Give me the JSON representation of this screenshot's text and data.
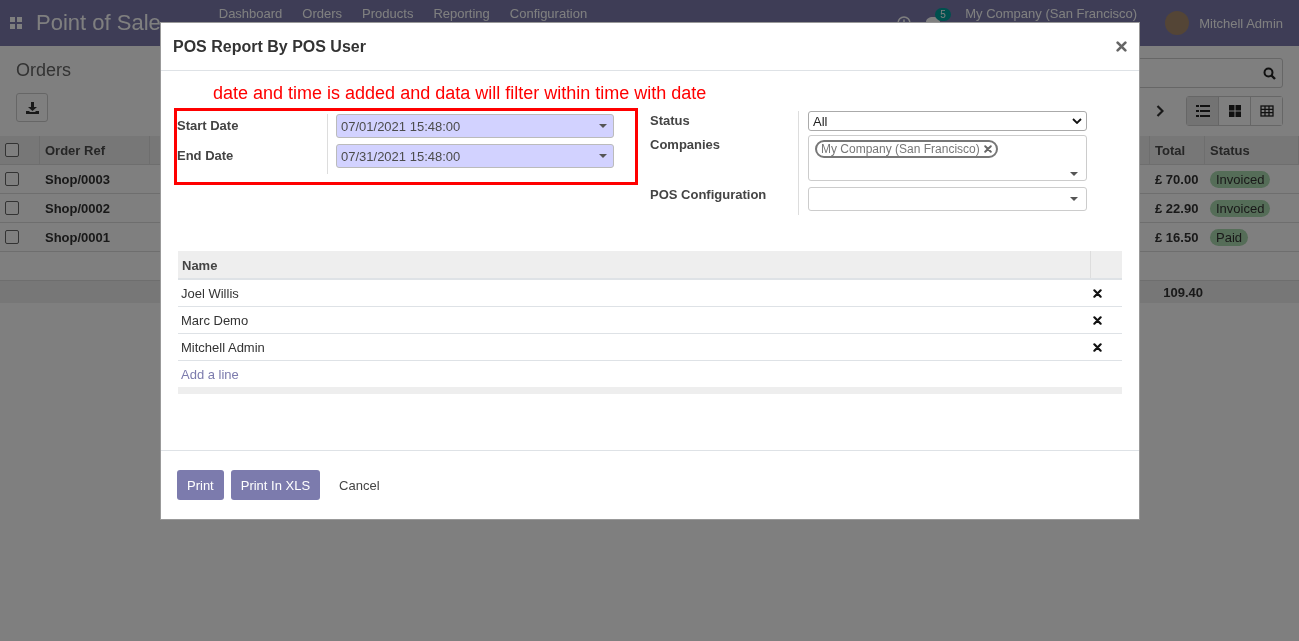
{
  "navbar": {
    "app_title": "Point of Sale",
    "menu": [
      "Dashboard",
      "Orders",
      "Products",
      "Reporting",
      "Configuration"
    ],
    "messages_badge": "5",
    "company": "My Company (San Francisco)",
    "user": "Mitchell Admin"
  },
  "control_panel": {
    "breadcrumb": "Orders",
    "views": [
      {
        "kind": "list",
        "selected": true
      },
      {
        "kind": "kanban",
        "selected": false
      },
      {
        "kind": "grid",
        "selected": false
      }
    ]
  },
  "orders_table": {
    "columns": [
      "Order Ref",
      "Total",
      "Status"
    ],
    "header_checked": false,
    "rows": [
      {
        "checked": false,
        "order_ref": "Shop/0003",
        "total": "£ 70.00",
        "status": "Invoiced"
      },
      {
        "checked": false,
        "order_ref": "Shop/0002",
        "total": "£ 22.90",
        "status": "Invoiced"
      },
      {
        "checked": false,
        "order_ref": "Shop/0001",
        "total": "£ 16.50",
        "status": "Paid"
      }
    ],
    "footer_total": "109.40"
  },
  "dialog": {
    "title": "POS Report By POS User",
    "annotation": "date and time is added and data will filter within time with date",
    "date_fields": [
      {
        "label": "Start Date",
        "value": "07/01/2021 15:48:00"
      },
      {
        "label": "End Date",
        "value": "07/31/2021 15:48:00"
      }
    ],
    "right_fields": [
      {
        "kind": "select",
        "label": "Status",
        "value": "All"
      },
      {
        "kind": "tags",
        "label": "Companies",
        "tags": [
          "My Company (San Francisco)"
        ]
      },
      {
        "kind": "many2one",
        "label": "POS Configuration"
      }
    ],
    "users_table": {
      "column": "Name",
      "rows": [
        "Joel Willis",
        "Marc Demo",
        "Mitchell Admin"
      ],
      "add_line": "Add a line"
    },
    "buttons": [
      {
        "kind": "primary",
        "label": "Print"
      },
      {
        "kind": "primary",
        "label": "Print In XLS"
      },
      {
        "kind": "link",
        "label": "Cancel"
      }
    ]
  }
}
